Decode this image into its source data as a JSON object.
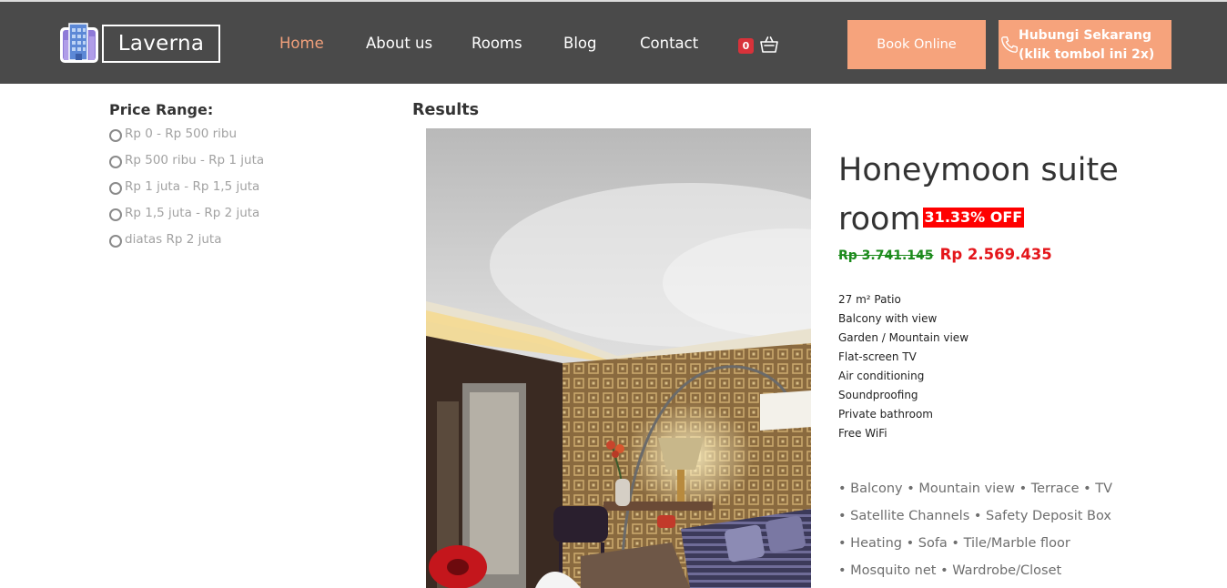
{
  "brand": {
    "name": "Laverna"
  },
  "nav": {
    "items": [
      {
        "label": "Home",
        "active": true
      },
      {
        "label": "About us",
        "active": false
      },
      {
        "label": "Rooms",
        "active": false
      },
      {
        "label": "Blog",
        "active": false
      },
      {
        "label": "Contact",
        "active": false
      }
    ],
    "cart_count": "0"
  },
  "header_buttons": {
    "book_label": "Book Online",
    "call_label": "Hubungi Sekarang (klik tombol ini 2x)"
  },
  "filter": {
    "title": "Price Range:",
    "options": [
      "Rp 0 - Rp 500 ribu",
      "Rp 500 ribu - Rp 1 juta",
      "Rp 1 juta - Rp 1,5 juta",
      "Rp 1,5 juta - Rp 2 juta",
      "diatas Rp 2 juta"
    ]
  },
  "results": {
    "title": "Results",
    "room": {
      "name": "Honeymoon suite room",
      "discount": "31.33% OFF",
      "old_price": "Rp 3.741.145",
      "new_price": "Rp 2.569.435",
      "features": [
        "27 m² Patio",
        "Balcony with view",
        "Garden / Mountain view",
        "Flat-screen TV",
        "Air conditioning",
        "Soundproofing",
        "Private bathroom",
        "Free WiFi"
      ],
      "amenity_lines": [
        "• Balcony • Mountain view • Terrace • TV",
        "• Satellite Channels • Safety Deposit Box",
        "• Heating • Sofa • Tile/Marble floor",
        "• Mosquito net • Wardrobe/Closet"
      ]
    }
  },
  "colors": {
    "header_bg": "#4a4a4a",
    "accent": "#f6a37c",
    "nav_active": "#f2a07b",
    "discount_bg": "#ff0000",
    "old_price": "#1b8a1b",
    "new_price": "#e4161b",
    "cart_badge": "#d8323a"
  },
  "icons": {
    "logo": "hotel-building-icon",
    "cart": "shopping-basket-icon",
    "call": "phone-icon",
    "filter_radio": "radio-button-icon"
  }
}
